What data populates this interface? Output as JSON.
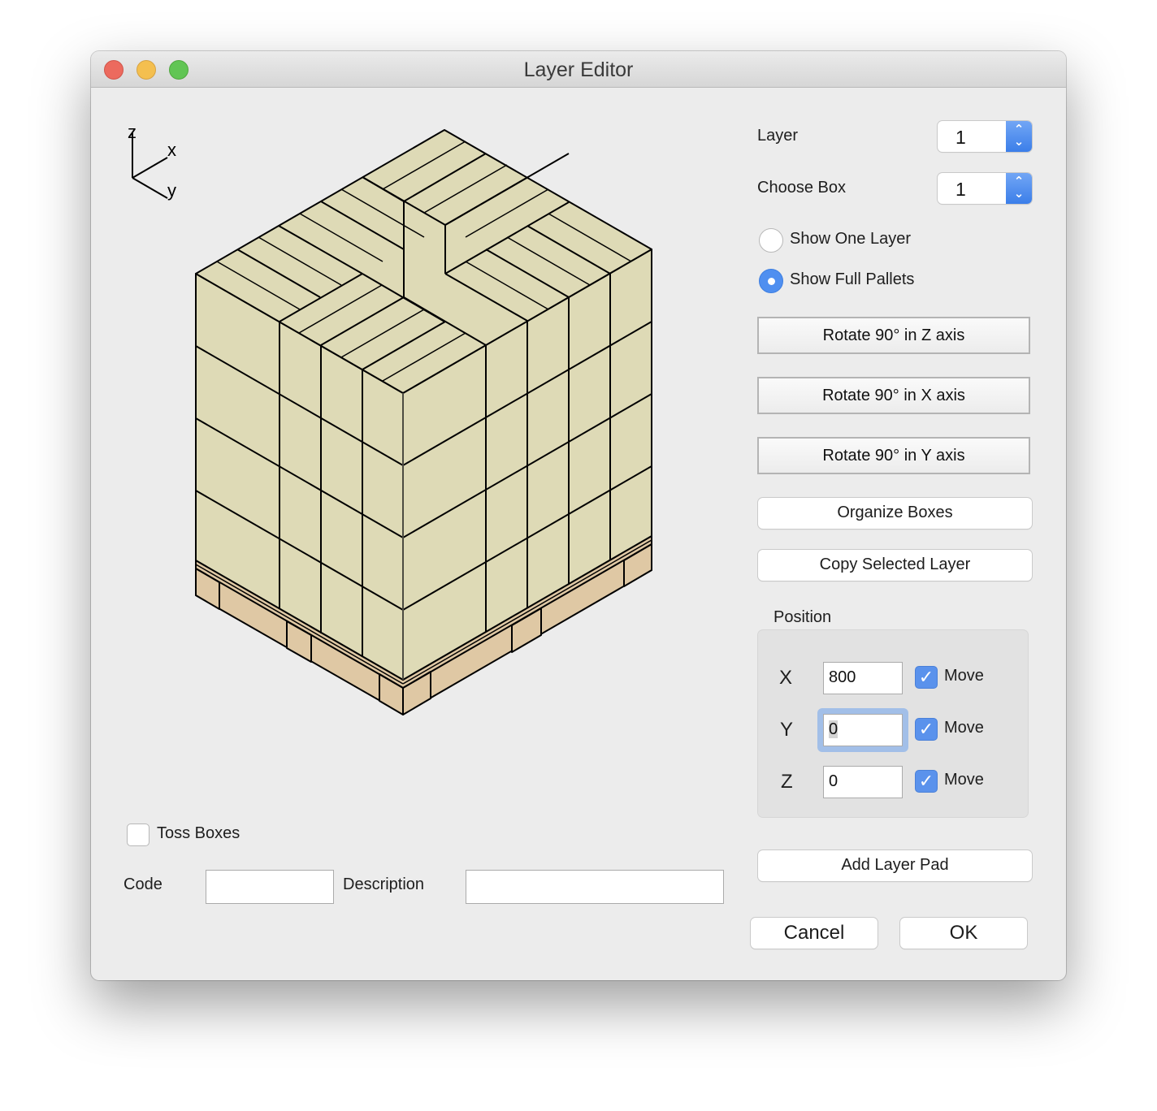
{
  "window": {
    "title": "Layer Editor",
    "controls": [
      "close",
      "minimize",
      "zoom"
    ]
  },
  "axis_indicator": {
    "z": "z",
    "x": "x",
    "y": "y"
  },
  "pallet_view": {
    "description": "Isometric view of full pallet with stacked boxes",
    "box_color": "#dedab6",
    "pallet_color": "#dfc8a4",
    "line_color": "#000000"
  },
  "controls": {
    "layer": {
      "label": "Layer",
      "value": "1"
    },
    "choose_box": {
      "label": "Choose Box",
      "value": "1"
    },
    "view_mode": {
      "options": [
        {
          "label": "Show One Layer",
          "selected": false
        },
        {
          "label": "Show Full Pallets",
          "selected": true
        }
      ]
    },
    "rotate_z": "Rotate 90° in Z axis",
    "rotate_x": "Rotate 90° in X axis",
    "rotate_y": "Rotate 90° in Y axis",
    "organize_boxes": "Organize Boxes",
    "copy_selected_layer": "Copy Selected Layer"
  },
  "position": {
    "label": "Position",
    "rows": [
      {
        "axis": "X",
        "value": "800",
        "move_label": "Move",
        "move_checked": true
      },
      {
        "axis": "Y",
        "value": "0",
        "move_label": "Move",
        "move_checked": true
      },
      {
        "axis": "Z",
        "value": "0",
        "move_label": "Move",
        "move_checked": true
      }
    ]
  },
  "add_layer_pad": "Add Layer Pad",
  "toss_boxes": {
    "label": "Toss Boxes",
    "checked": false
  },
  "code": {
    "label": "Code",
    "value": ""
  },
  "description": {
    "label": "Description",
    "value": ""
  },
  "footer": {
    "cancel": "Cancel",
    "ok": "OK"
  },
  "colors": {
    "accent": "#4f8ff0",
    "window_bg": "#ececec"
  }
}
